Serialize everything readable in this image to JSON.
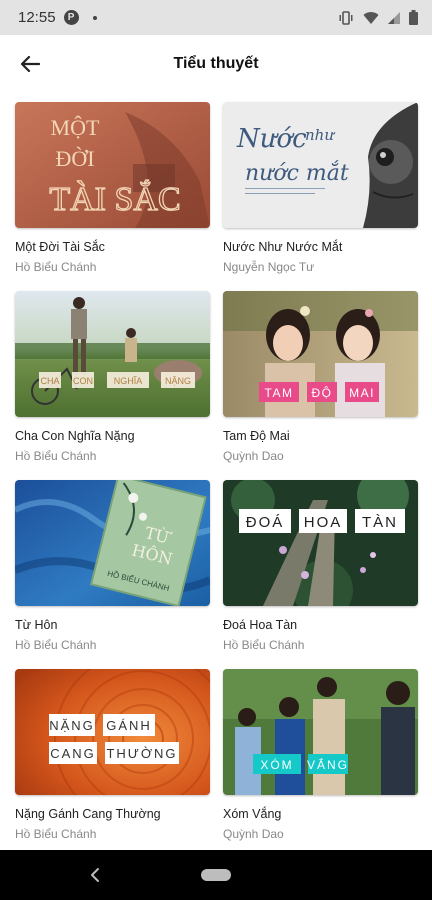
{
  "status": {
    "time": "12:55",
    "p_badge": "P"
  },
  "header": {
    "title": "Tiểu thuyết"
  },
  "books": [
    {
      "title": "Một Đời Tài Sắc",
      "author": "Hồ Biểu Chánh",
      "cover_text": [
        "MỘT",
        "ĐỜI",
        "TÀI SẮC"
      ]
    },
    {
      "title": "Nước Như Nước Mắt",
      "author": "Nguyễn Ngọc Tư",
      "cover_text": [
        "Nước",
        "như",
        "nước mắt"
      ]
    },
    {
      "title": "Cha Con Nghĩa Nặng",
      "author": "Hồ Biểu Chánh",
      "cover_text": [
        "CHA",
        "CON",
        "NGHĨA",
        "NẶNG"
      ]
    },
    {
      "title": "Tam Độ Mai",
      "author": "Quỳnh Dao",
      "cover_text": [
        "TAM",
        "ĐỘ",
        "MAI"
      ]
    },
    {
      "title": "Từ Hôn",
      "author": "Hồ Biểu Chánh",
      "cover_text": [
        "TỪ",
        "HÔN",
        "HỒ BIỂU CHÁNH"
      ]
    },
    {
      "title": "Đoá Hoa Tàn",
      "author": "Hồ Biểu Chánh",
      "cover_text": [
        "ĐOÁ",
        "HOA",
        "TÀN"
      ]
    },
    {
      "title": "Nặng Gánh Cang Thường",
      "author": "Hồ Biểu Chánh",
      "cover_text": [
        "NẶNG",
        "GÁNH",
        "CANG",
        "THƯỜNG"
      ]
    },
    {
      "title": "Xóm Vắng",
      "author": "Quỳnh Dao",
      "cover_text": [
        "XÓM",
        "VẮNG"
      ]
    }
  ]
}
